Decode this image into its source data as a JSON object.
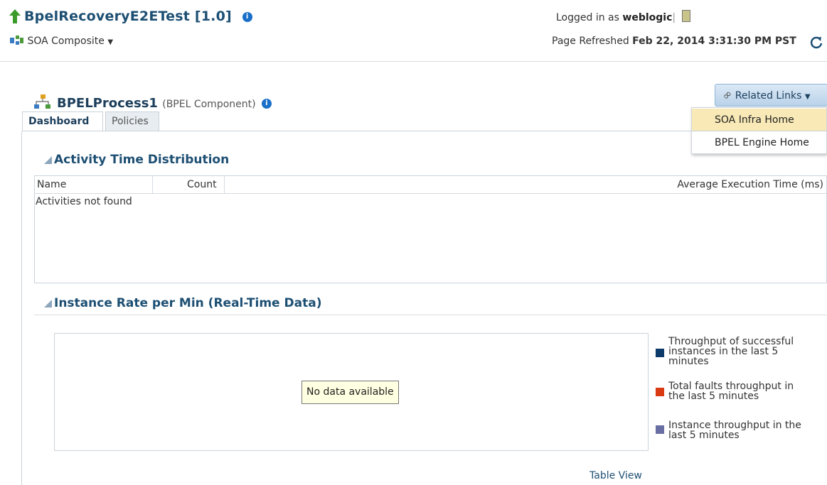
{
  "header": {
    "title": "BpelRecoveryE2ETest [1.0]",
    "composite_label": "SOA Composite",
    "logged_in_prefix": "Logged in as",
    "username": "weblogic",
    "refreshed_prefix": "Page Refreshed",
    "refreshed_time": "Feb 22, 2014 3:31:30 PM PST"
  },
  "component": {
    "name": "BPELProcess1",
    "type": "(BPEL Component)"
  },
  "related_links": {
    "label": "Related Links",
    "items": [
      "SOA Infra Home",
      "BPEL Engine Home"
    ]
  },
  "tabs": [
    "Dashboard",
    "Policies"
  ],
  "activity": {
    "title": "Activity Time Distribution",
    "columns": [
      "Name",
      "Count",
      "Average Execution Time (ms)"
    ],
    "empty_message": "Activities not found"
  },
  "instance_rate": {
    "title": "Instance Rate per Min (Real-Time Data)",
    "no_data": "No data available",
    "legend": [
      {
        "label": "Throughput of successful instances in the last 5 minutes",
        "color": "#0c3a6b"
      },
      {
        "label": "Total faults throughput in the last 5 minutes",
        "color": "#d93a12"
      },
      {
        "label": "Instance throughput in the last 5 minutes",
        "color": "#6a6fa3"
      }
    ],
    "table_view": "Table View"
  }
}
